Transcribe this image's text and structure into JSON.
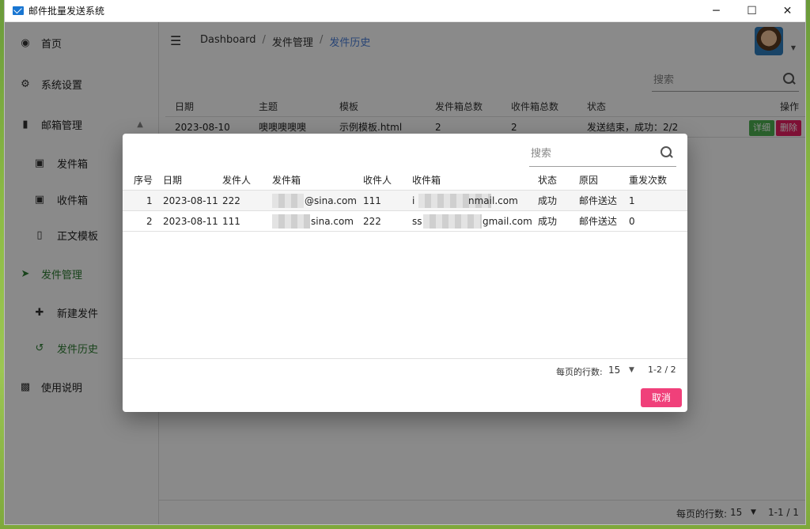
{
  "window": {
    "title": "邮件批量发送系统",
    "minimize": "─",
    "maximize": "☐",
    "close": "✕"
  },
  "sidebar": {
    "items": [
      {
        "label": "首页",
        "icon": "dashboard-icon"
      },
      {
        "label": "系统设置",
        "icon": "settings-icon"
      },
      {
        "label": "邮箱管理",
        "icon": "bar-chart-icon"
      },
      {
        "label": "发件箱",
        "icon": "outbox-icon"
      },
      {
        "label": "收件箱",
        "icon": "inbox-icon"
      },
      {
        "label": "正文模板",
        "icon": "template-icon"
      },
      {
        "label": "发件管理",
        "icon": "send-icon"
      },
      {
        "label": "新建发件",
        "icon": "plus-icon"
      },
      {
        "label": "发件历史",
        "icon": "history-icon"
      },
      {
        "label": "使用说明",
        "icon": "book-icon"
      }
    ]
  },
  "header": {
    "breadcrumb": [
      "Dashboard",
      "发件管理",
      "发件历史"
    ],
    "separator": "/"
  },
  "main_search": {
    "placeholder": "搜索"
  },
  "main_table": {
    "headers": [
      "日期",
      "主题",
      "模板",
      "发件箱总数",
      "收件箱总数",
      "状态",
      "操作"
    ],
    "rows": [
      {
        "date": "2023-08-10",
        "subject": "噢噢噢噢噢",
        "template": "示例模板.html",
        "sender_total": "2",
        "receiver_total": "2",
        "status": "发送结束，成功：2/2",
        "detail": "详细",
        "delete": "删除"
      }
    ]
  },
  "main_footer": {
    "rows_per_page_label": "每页的行数:",
    "rows_per_page": "15",
    "range": "1-1 / 1"
  },
  "dialog": {
    "search_placeholder": "搜索",
    "headers": [
      "序号",
      "日期",
      "发件人",
      "发件箱",
      "收件人",
      "收件箱",
      "状态",
      "原因",
      "重发次数"
    ],
    "rows": [
      {
        "index": "1",
        "date": "2023-08-11",
        "sender": "222",
        "sender_box": "@sina.com",
        "receiver": "111",
        "receiver_prefix": "i",
        "receiver_box": "nmail.com",
        "status": "成功",
        "reason": "邮件送达",
        "retries": "1"
      },
      {
        "index": "2",
        "date": "2023-08-11",
        "sender": "111",
        "sender_box": "sina.com",
        "receiver": "222",
        "receiver_prefix": "ss",
        "receiver_box": "gmail.com",
        "status": "成功",
        "reason": "邮件送达",
        "retries": "0"
      }
    ],
    "rows_per_page_label": "每页的行数:",
    "rows_per_page": "15",
    "range": "1-2 / 2",
    "cancel": "取消"
  }
}
